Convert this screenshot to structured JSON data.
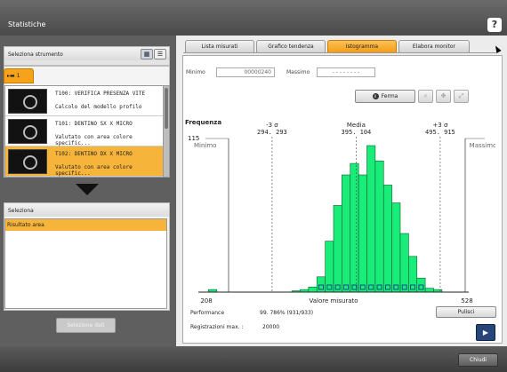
{
  "window": {
    "title": "Statistiche",
    "help_label": "?"
  },
  "left_panel": {
    "tool_header": "Seleziona strumento",
    "filter_tab_label": "▸▬ 1",
    "tools": [
      {
        "name": "T100: VERIFICA PRESENZA VITE",
        "description": "Calcolo del modello profilo",
        "selected": false
      },
      {
        "name": "T101: DENTINO SX X MICRO",
        "description": "Valutato con area colore specific...",
        "selected": false
      },
      {
        "name": "T102: DENTINO DX X MICRO",
        "description": "Valutato con area colore specific...",
        "selected": true
      }
    ],
    "selection_header": "Seleziona",
    "selection_items": [
      "Risultato area"
    ],
    "select_data_button": "Seleziona dati"
  },
  "tabs": [
    {
      "label": "Lista misurati",
      "active": false
    },
    {
      "label": "Grafico tendenza",
      "active": false
    },
    {
      "label": "Istogramma",
      "active": true
    },
    {
      "label": "Elabora monitor",
      "active": false
    }
  ],
  "filters": {
    "min_label": "Minimo",
    "min_value": "00000240",
    "max_label": "Massimo",
    "max_value": "- - - - - - - -"
  },
  "toolbar": {
    "stop_button": "Ferma",
    "stop_icon_glyph": "II",
    "icons": [
      "search-icon",
      "pan-icon",
      "fit-icon"
    ]
  },
  "chart_data": {
    "type": "bar",
    "title": "Frequenza",
    "xlabel": "Valore misurato",
    "x_min": 208,
    "x_max": 528,
    "y_max_label": "115",
    "min_marker_label": "Minimo",
    "max_marker_label": "Massimo",
    "markers": [
      {
        "name": "-3 σ",
        "value": 294.293,
        "text": "294. 293"
      },
      {
        "name": "Media",
        "value": 395.104,
        "text": "395. 104"
      },
      {
        "name": "+3 σ",
        "value": 495.915,
        "text": "495. 915"
      }
    ],
    "bar_color": "#19ec78",
    "bin_start": 208,
    "bin_width": 10,
    "values": [
      0,
      2,
      0,
      0,
      0,
      0,
      0,
      0,
      0,
      0,
      0,
      1,
      2,
      4,
      12,
      40,
      68,
      92,
      101,
      92,
      115,
      103,
      84,
      70,
      46,
      28,
      11,
      3,
      2,
      0,
      0,
      0
    ]
  },
  "stats": {
    "performance_label": "Performance",
    "performance_value": "99. 786% (931/933)",
    "records_label": "Registrazioni max. :",
    "records_value": "20000",
    "clear_button": "Pulisci"
  },
  "footer": {
    "close_button": "Chiudi"
  }
}
